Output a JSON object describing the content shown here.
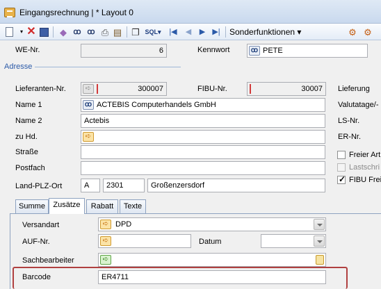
{
  "window": {
    "title": "Eingangsrechnung | * Layout 0"
  },
  "toolbar": {
    "icons": [
      "new-doc-icon",
      "delete-icon",
      "save-icon",
      "eraser-icon",
      "binoculars-icon",
      "binoculars-multi-icon",
      "print-icon",
      "report-icon",
      "copy-icon",
      "sql-icon",
      "first-icon",
      "prev-icon",
      "next-icon",
      "last-icon"
    ],
    "sql_label": "SQL",
    "menu_label": "Sonderfunktionen"
  },
  "header": {
    "we_nr_label": "WE-Nr.",
    "we_nr_value": "6",
    "kennwort_label": "Kennwort",
    "kennwort_value": "PETE",
    "adresse_label": "Adresse"
  },
  "address": {
    "lieferanten_label": "Lieferanten-Nr.",
    "lieferanten_value": "300007",
    "fibu_label": "FIBU-Nr.",
    "fibu_value": "30007",
    "name1_label": "Name 1",
    "name1_value": "ACTEBIS Computerhandels GmbH",
    "name2_label": "Name 2",
    "name2_value": "Actebis",
    "zuhd_label": "zu Hd.",
    "zuhd_value": "",
    "strasse_label": "Straße",
    "strasse_value": "",
    "postfach_label": "Postfach",
    "postfach_value": "",
    "land_plz_ort_label": "Land-PLZ-Ort",
    "land_value": "A",
    "plz_value": "2301",
    "ort_value": "Großenzersdorf"
  },
  "right_panel": {
    "lieferung_label": "Lieferung",
    "valutatage_label": "Valutatage/-",
    "lsnr_label": "LS-Nr.",
    "ernr_label": "ER-Nr.",
    "freier_label": "Freier Art",
    "lastschrift_label": "Lastschri",
    "fibu_frei_label": "FIBU Frei",
    "fibu_frei_checked": true
  },
  "tabs": [
    "Summe",
    "Zusätze",
    "Rabatt",
    "Texte"
  ],
  "active_tab": "Zusätze",
  "zusaetze": {
    "versandart_label": "Versandart",
    "versandart_value": "DPD",
    "auf_label": "AUF-Nr.",
    "auf_value": "",
    "datum_label": "Datum",
    "datum_value": "",
    "sachbearbeiter_label": "Sachbearbeiter",
    "sachbearbeiter_value": "",
    "barcode_label": "Barcode",
    "barcode_value": "ER4711"
  },
  "colors": {
    "highlight_border": "#b04040",
    "accent_blue": "#2b5aa8",
    "checkmark": "#000000"
  }
}
